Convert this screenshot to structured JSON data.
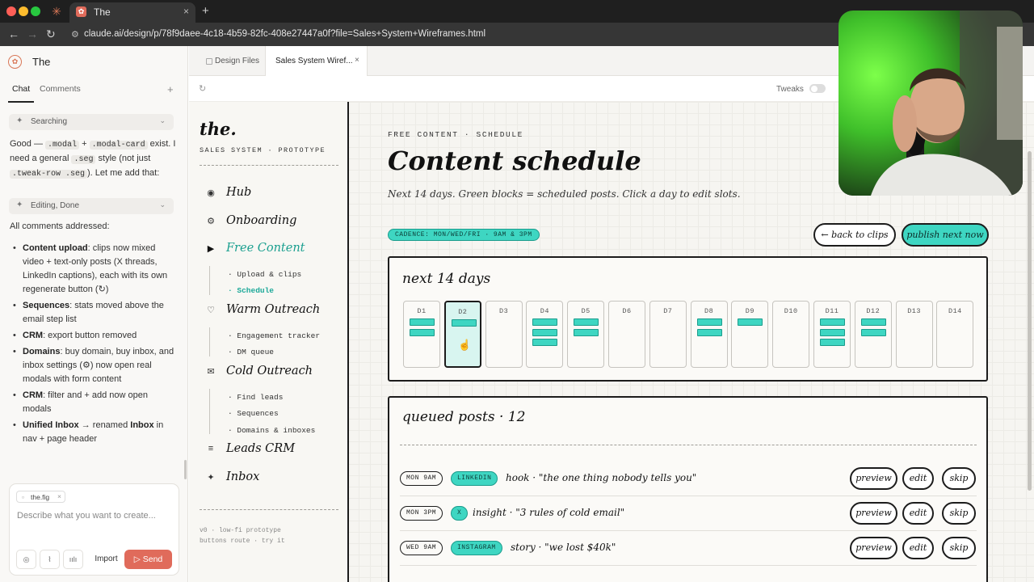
{
  "browser": {
    "tab_title": "The",
    "url": "claude.ai/design/p/78f9daee-4c18-4b59-82fc-408e27447a0f?file=Sales+System+Wireframes.html",
    "new_tab": "+",
    "close": "×"
  },
  "app": {
    "project_title": "The",
    "tabs": {
      "chat": "Chat",
      "comments": "Comments",
      "plus": "+"
    },
    "status1": "Searching",
    "status2": "Editing, Done",
    "msg1": {
      "a": "Good — ",
      "code1": ".modal",
      "b": " + ",
      "code2": ".modal-card",
      "c": " exist. I need a general ",
      "code3": ".seg",
      "d": " style (not just ",
      "code4": ".tweak-row .seg",
      "e": "). Let me add that:"
    },
    "summary": "All comments addressed:",
    "bullets": [
      {
        "bold": "Content upload",
        "text": ": clips now mixed video + text-only posts (X threads, LinkedIn captions), each with its own regenerate button (↻)"
      },
      {
        "bold": "Sequences",
        "text": ": stats moved above the email step list"
      },
      {
        "bold": "CRM",
        "text": ": export button removed"
      },
      {
        "bold": "Domains",
        "text": ": buy domain, buy inbox, and inbox settings (⚙) now open real modals with form content"
      },
      {
        "bold": "CRM",
        "text": ": filter and + add now open modals"
      },
      {
        "bold": "Unified Inbox",
        "text": " → renamed ",
        "bold2": "Inbox",
        "text2": " in nav + page header"
      }
    ],
    "composer": {
      "file_chip": "the.fig",
      "placeholder": "Describe what you want to create...",
      "import": "Import",
      "send": "Send"
    }
  },
  "canvas": {
    "tabs": {
      "design_files": "Design Files",
      "sales": "Sales System Wiref..."
    },
    "tweaks_label": "Tweaks",
    "tweaks_on": false
  },
  "proto": {
    "brand": "the.",
    "brand_sub": "SALES SYSTEM · PROTOTYPE",
    "nav": {
      "hub": "Hub",
      "onboarding": "Onboarding",
      "free_content": "Free Content",
      "upload": "· Upload & clips",
      "schedule": "· Schedule",
      "warm_outreach": "Warm Outreach",
      "engagement": "· Engagement tracker",
      "dm_queue": "· DM queue",
      "cold_outreach": "Cold Outreach",
      "find_leads": "· Find leads",
      "sequences": "· Sequences",
      "domains": "· Domains & inboxes",
      "leads_crm": "Leads CRM",
      "inbox": "Inbox"
    },
    "footer1": "v0 · low-fi prototype",
    "footer2": "buttons route · try it",
    "eyebrow": "FREE CONTENT · SCHEDULE",
    "title": "Content schedule",
    "desc": "Next 14 days. Green blocks = scheduled posts. Click a day to edit slots.",
    "cadence": "CADENCE: MON/WED/FRI · 9AM & 3PM",
    "back_btn": "← back to clips",
    "publish_btn": "publish next now",
    "days_title": "next 14 days",
    "days": [
      {
        "label": "D1",
        "posts": 2,
        "selected": false
      },
      {
        "label": "D2",
        "posts": 1,
        "selected": true
      },
      {
        "label": "D3",
        "posts": 0,
        "selected": false
      },
      {
        "label": "D4",
        "posts": 3,
        "selected": false
      },
      {
        "label": "D5",
        "posts": 2,
        "selected": false
      },
      {
        "label": "D6",
        "posts": 0,
        "selected": false
      },
      {
        "label": "D7",
        "posts": 0,
        "selected": false
      },
      {
        "label": "D8",
        "posts": 2,
        "selected": false
      },
      {
        "label": "D9",
        "posts": 1,
        "selected": false
      },
      {
        "label": "D10",
        "posts": 0,
        "selected": false
      },
      {
        "label": "D11",
        "posts": 3,
        "selected": false
      },
      {
        "label": "D12",
        "posts": 2,
        "selected": false
      },
      {
        "label": "D13",
        "posts": 0,
        "selected": false
      },
      {
        "label": "D14",
        "posts": 0,
        "selected": false
      }
    ],
    "queue_title": "queued posts · 12",
    "queue": [
      {
        "time": "MON 9AM",
        "channel": "LINKEDIN",
        "text": "hook · \"the one thing nobody tells you\""
      },
      {
        "time": "MON 3PM",
        "channel": "X",
        "text": "insight · \"3 rules of cold email\""
      },
      {
        "time": "WED 9AM",
        "channel": "INSTAGRAM",
        "text": "story · \"we lost $40k\""
      }
    ],
    "actions": {
      "preview": "preview",
      "edit": "edit",
      "skip": "skip"
    }
  }
}
